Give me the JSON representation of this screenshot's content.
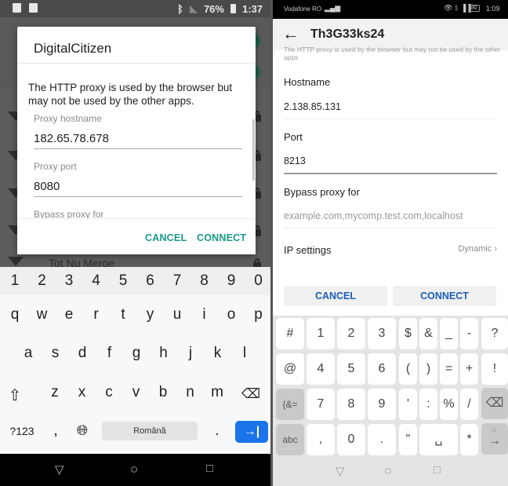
{
  "left_phone": {
    "status_bar": {
      "battery": "76%",
      "time": "1:37",
      "icons": [
        "notes-icon",
        "image-icon",
        "bluetooth-icon",
        "no-sim-icon",
        "battery-charging-icon"
      ]
    },
    "background_network": "Tot Nu Merge",
    "dialog": {
      "title": "DigitalCitizen",
      "description": "The HTTP proxy is used by the browser but may not be used by the other apps.",
      "hostname_label": "Proxy hostname",
      "hostname_value": "182.65.78.678",
      "port_label": "Proxy port",
      "port_value": "8080",
      "bypass_label": "Bypass proxy for",
      "cancel_label": "CANCEL",
      "connect_label": "CONNECT"
    },
    "keyboard": {
      "number_row": [
        "1",
        "2",
        "3",
        "4",
        "5",
        "6",
        "7",
        "8",
        "9",
        "0"
      ],
      "row1": [
        "q",
        "w",
        "e",
        "r",
        "t",
        "y",
        "u",
        "i",
        "o",
        "p"
      ],
      "row2": [
        "a",
        "s",
        "d",
        "f",
        "g",
        "h",
        "j",
        "k",
        "l"
      ],
      "row3": [
        "z",
        "x",
        "c",
        "v",
        "b",
        "n",
        "m"
      ],
      "symbols_key": "?123",
      "comma_key": ",",
      "space_label": "Română",
      "period_key": ".",
      "enter_glyph": "→|"
    },
    "accent_color": "#19998a"
  },
  "right_phone": {
    "status_bar": {
      "carrier": "Vodafone RO",
      "battery": "80",
      "time": "1:09"
    },
    "title": "Th3G33ks24",
    "faded_text": "The HTTP proxy is used by the browser but may not be used by the other apps",
    "hostname_label": "Hostname",
    "hostname_value": "2.138.85.131",
    "port_label": "Port",
    "port_value": "8213",
    "bypass_label": "Bypass proxy for",
    "bypass_placeholder": "example.com,mycomp.test.com,localhost",
    "ip_settings_label": "IP settings",
    "ip_settings_value": "Dynamic",
    "cancel_label": "CANCEL",
    "connect_label": "CONNECT",
    "keyboard": {
      "row1": [
        "#",
        "1",
        "2",
        "3",
        "$",
        "&",
        "_",
        "-",
        "?"
      ],
      "row2": [
        "@",
        "4",
        "5",
        "6",
        "(",
        ")",
        "=",
        "+",
        "!"
      ],
      "row3": [
        "{&=",
        "7",
        "8",
        "9",
        "'",
        ":",
        "%",
        "/"
      ],
      "row4": [
        "abc",
        ",",
        "0",
        ".",
        "\"",
        "*"
      ]
    },
    "accent_color": "#1b5fb6"
  }
}
